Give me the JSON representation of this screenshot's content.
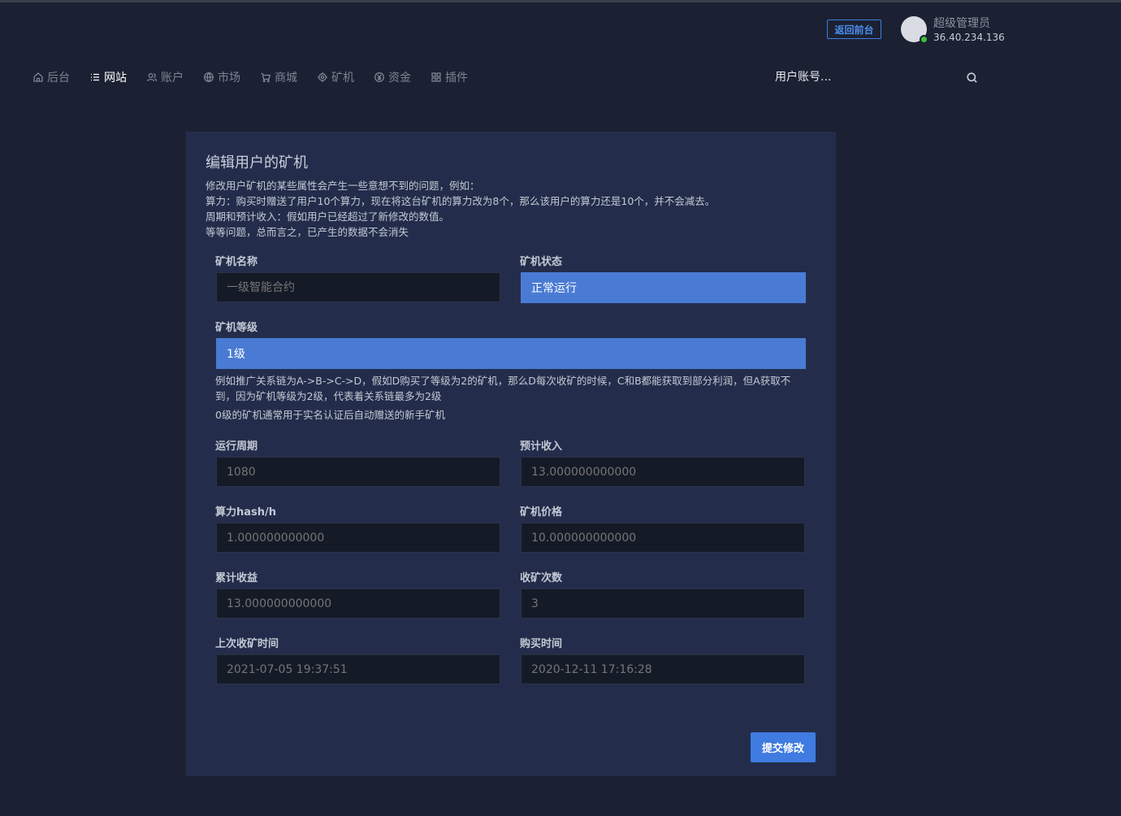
{
  "header": {
    "back_button": "返回前台",
    "user_name": "超级管理员",
    "user_ip": "36.40.234.136"
  },
  "nav": {
    "items": [
      {
        "label": "后台",
        "icon": "home-icon"
      },
      {
        "label": "网站",
        "icon": "list-icon"
      },
      {
        "label": "账户",
        "icon": "users-icon"
      },
      {
        "label": "市场",
        "icon": "globe-icon"
      },
      {
        "label": "商城",
        "icon": "cart-icon"
      },
      {
        "label": "矿机",
        "icon": "cpu-icon"
      },
      {
        "label": "资金",
        "icon": "coin-icon"
      },
      {
        "label": "插件",
        "icon": "grid-icon"
      }
    ],
    "active_index": 1,
    "search_placeholder": "用户账号..."
  },
  "form": {
    "title": "编辑用户的矿机",
    "notes": [
      "修改用户矿机的某些属性会产生一些意想不到的问题，例如：",
      "算力：购买时赠送了用户10个算力，现在将这台矿机的算力改为8个，那么该用户的算力还是10个，并不会减去。",
      "周期和预计收入：假如用户已经超过了新修改的数值。",
      "等等问题，总而言之，已产生的数据不会消失"
    ],
    "name": {
      "label": "矿机名称",
      "placeholder": "一级智能合约"
    },
    "status": {
      "label": "矿机状态",
      "value": "正常运行"
    },
    "level": {
      "label": "矿机等级",
      "value": "1级"
    },
    "level_hint_1": "例如推广关系链为A->B->C->D，假如D购买了等级为2的矿机，那么D每次收矿的时候，C和B都能获取到部分利润，但A获取不到，因为矿机等级为2级，代表着关系链最多为2级",
    "level_hint_2": "0级的矿机通常用于实名认证后自动赠送的新手矿机",
    "period": {
      "label": "运行周期",
      "placeholder": "1080"
    },
    "expected_income": {
      "label": "预计收入",
      "placeholder": "13.000000000000"
    },
    "hashrate": {
      "label": "算力hash/h",
      "placeholder": "1.000000000000"
    },
    "price": {
      "label": "矿机价格",
      "placeholder": "10.000000000000"
    },
    "total_income": {
      "label": "累计收益",
      "placeholder": "13.000000000000"
    },
    "collect_count": {
      "label": "收矿次数",
      "placeholder": "3"
    },
    "last_collect_time": {
      "label": "上次收矿时间",
      "placeholder": "2021-07-05 19:37:51"
    },
    "purchase_time": {
      "label": "购买时间",
      "placeholder": "2020-12-11 17:16:28"
    },
    "submit": "提交修改"
  }
}
